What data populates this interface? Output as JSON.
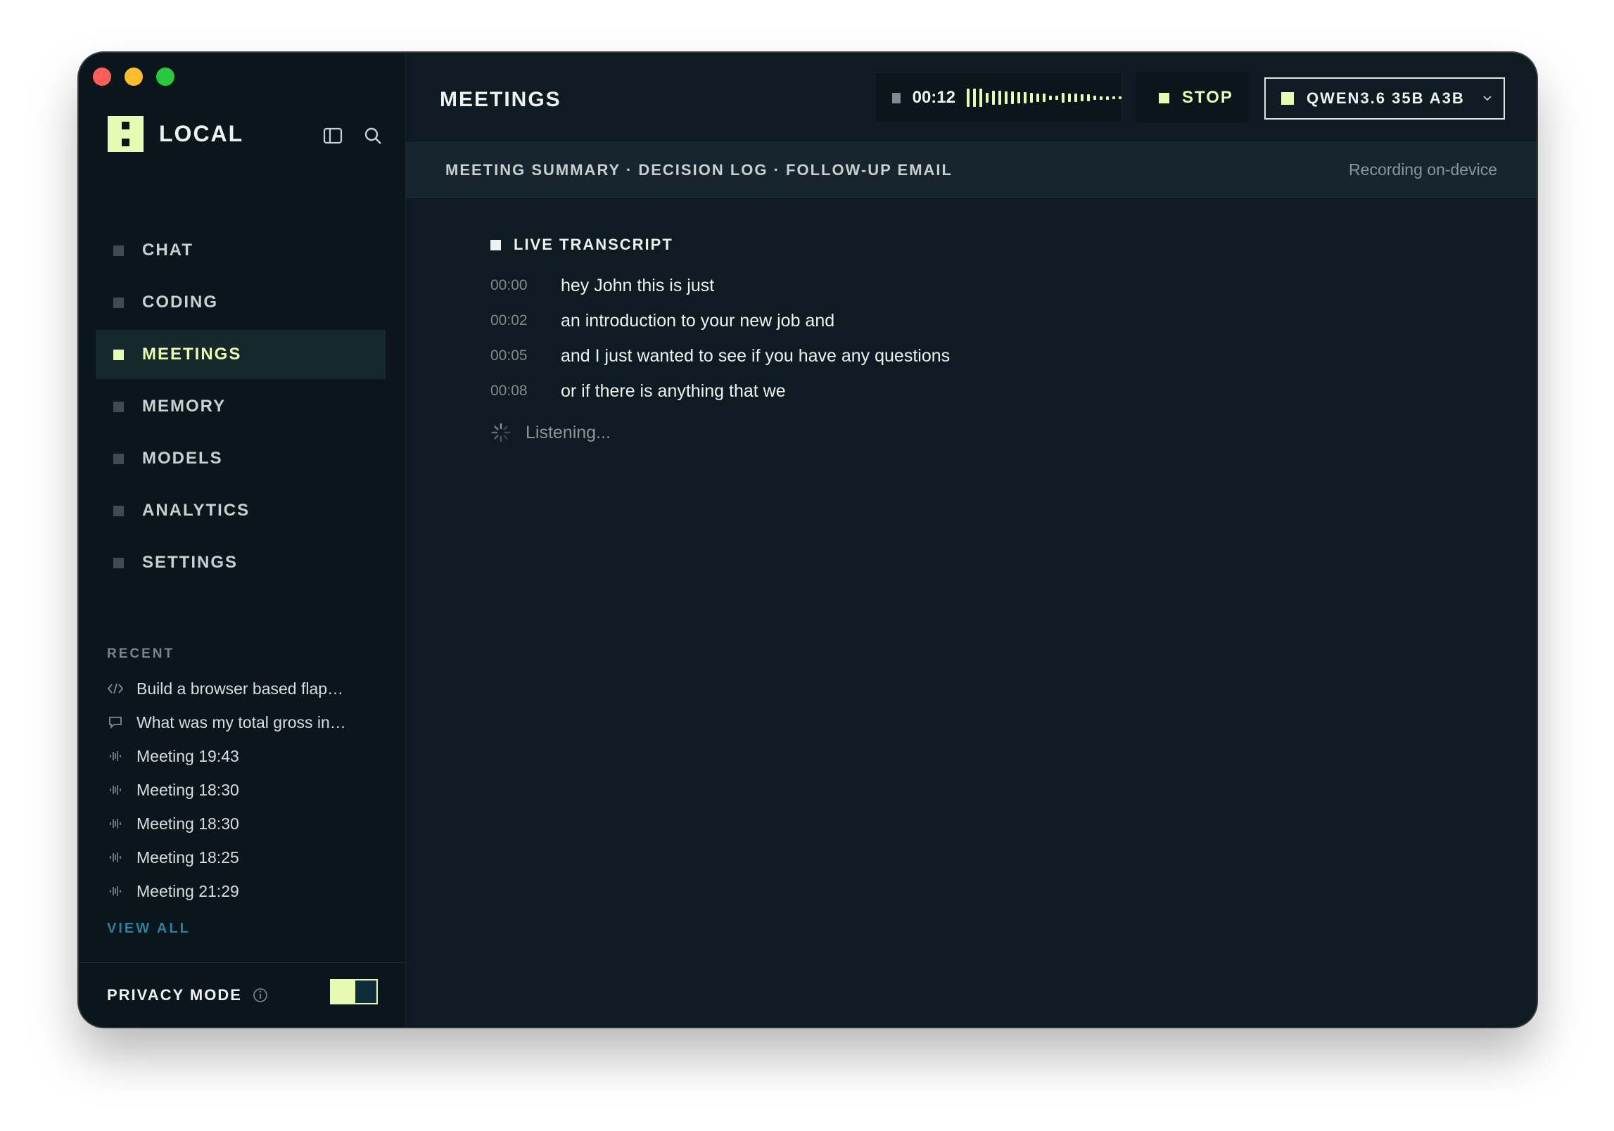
{
  "window": {
    "traffic_lights": [
      "#ff5f57",
      "#febc2e",
      "#28c840"
    ]
  },
  "brand": {
    "name": "LOCAL",
    "accent": "#e6fab4"
  },
  "sidebar": {
    "tools": [
      {
        "icon": "sidebar-toggle-icon"
      },
      {
        "icon": "search-icon"
      }
    ],
    "nav": [
      {
        "label": "CHAT",
        "active": false
      },
      {
        "label": "CODING",
        "active": false
      },
      {
        "label": "MEETINGS",
        "active": true
      },
      {
        "label": "MEMORY",
        "active": false
      },
      {
        "label": "MODELS",
        "active": false
      },
      {
        "label": "ANALYTICS",
        "active": false
      },
      {
        "label": "SETTINGS",
        "active": false
      }
    ],
    "recent_heading": "RECENT",
    "recent": [
      {
        "icon": "code-icon",
        "label": "Build a browser based flap…"
      },
      {
        "icon": "chat-bubble-icon",
        "label": "What was my total gross in…"
      },
      {
        "icon": "waveform-icon",
        "label": "Meeting 19:43"
      },
      {
        "icon": "waveform-icon",
        "label": "Meeting 18:30"
      },
      {
        "icon": "waveform-icon",
        "label": "Meeting 18:30"
      },
      {
        "icon": "waveform-icon",
        "label": "Meeting 18:25"
      },
      {
        "icon": "waveform-icon",
        "label": "Meeting 21:29"
      }
    ],
    "view_all": "VIEW ALL",
    "privacy": {
      "label": "PRIVACY MODE",
      "enabled": true
    }
  },
  "header": {
    "title": "MEETINGS",
    "timer": "00:12",
    "stop_label": "STOP",
    "model_label": "QWEN3.6 35B A3B"
  },
  "subbar": {
    "tabs": [
      "MEETING SUMMARY",
      "DECISION LOG",
      "FOLLOW-UP EMAIL"
    ],
    "separator": " · ",
    "status": "Recording on-device"
  },
  "transcript": {
    "heading": "LIVE TRANSCRIPT",
    "lines": [
      {
        "time": "00:00",
        "text": "hey John this is just"
      },
      {
        "time": "00:02",
        "text": "an introduction to your new job and"
      },
      {
        "time": "00:05",
        "text": "and I just wanted to see if you have any questions"
      },
      {
        "time": "00:08",
        "text": "or if there is anything that we"
      }
    ],
    "listening": "Listening..."
  }
}
